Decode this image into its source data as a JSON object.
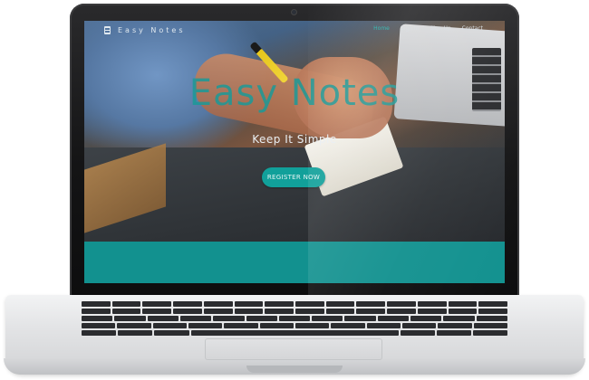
{
  "nav": {
    "brand": "Easy Notes",
    "links": [
      "Home",
      "Sign In",
      "Sign Up",
      "Contact"
    ],
    "active_index": 0
  },
  "hero": {
    "title": "Easy Notes",
    "subtitle": "Keep It Simple",
    "cta_label": "REGISTER NOW"
  },
  "colors": {
    "accent": "#12918f",
    "button": "#11a09a",
    "active_link": "#2ab2ad"
  }
}
